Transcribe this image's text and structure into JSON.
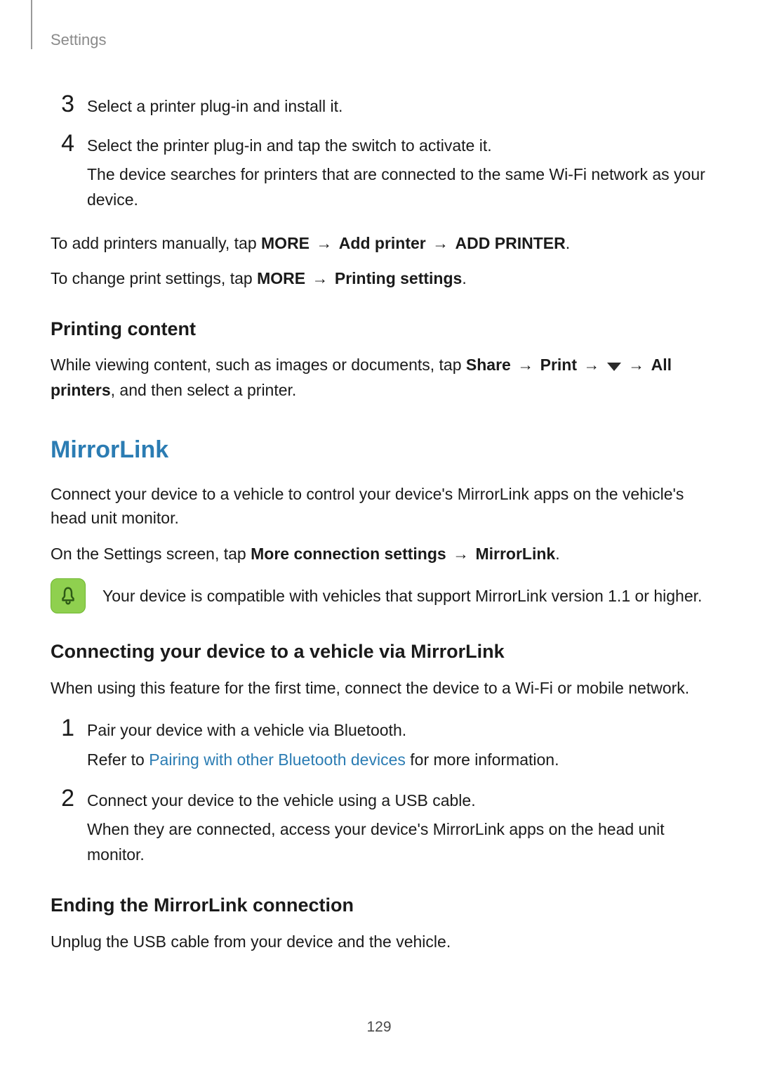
{
  "header": {
    "breadcrumb": "Settings"
  },
  "steps_top": {
    "s3": {
      "num": "3",
      "text": "Select a printer plug-in and install it."
    },
    "s4": {
      "num": "4",
      "line1": "Select the printer plug-in and tap the switch to activate it.",
      "line2": "The device searches for printers that are connected to the same Wi-Fi network as your device."
    }
  },
  "add_printers_line": {
    "prefix": "To add printers manually, tap ",
    "more": "MORE",
    "arrow": " → ",
    "add_printer": "Add printer",
    "ADD_PRINTER": "ADD PRINTER",
    "period": "."
  },
  "change_settings_line": {
    "prefix": "To change print settings, tap ",
    "more": "MORE",
    "arrow": " → ",
    "printing_settings": "Printing settings",
    "period": "."
  },
  "printing_content": {
    "heading": "Printing content",
    "prefix": "While viewing content, such as images or documents, tap ",
    "share": "Share",
    "arrow": " → ",
    "print": "Print",
    "all_printers": "All printers",
    "suffix": ", and then select a printer."
  },
  "mirrorlink": {
    "heading": "MirrorLink",
    "intro": "Connect your device to a vehicle to control your device's MirrorLink apps on the vehicle's head unit monitor.",
    "instruction_prefix": "On the Settings screen, tap ",
    "more_connection": "More connection settings",
    "arrow": " → ",
    "mirrorlink_label": "MirrorLink",
    "period": ".",
    "note": "Your device is compatible with vehicles that support MirrorLink version 1.1 or higher."
  },
  "connecting": {
    "heading": "Connecting your device to a vehicle via MirrorLink",
    "intro": "When using this feature for the first time, connect the device to a Wi-Fi or mobile network.",
    "s1": {
      "num": "1",
      "line1": "Pair your device with a vehicle via Bluetooth.",
      "refer_prefix": "Refer to ",
      "refer_link": "Pairing with other Bluetooth devices",
      "refer_suffix": " for more information."
    },
    "s2": {
      "num": "2",
      "line1": "Connect your device to the vehicle using a USB cable.",
      "line2": "When they are connected, access your device's MirrorLink apps on the head unit monitor."
    }
  },
  "ending": {
    "heading": "Ending the MirrorLink connection",
    "text": "Unplug the USB cable from your device and the vehicle."
  },
  "page_number": "129"
}
